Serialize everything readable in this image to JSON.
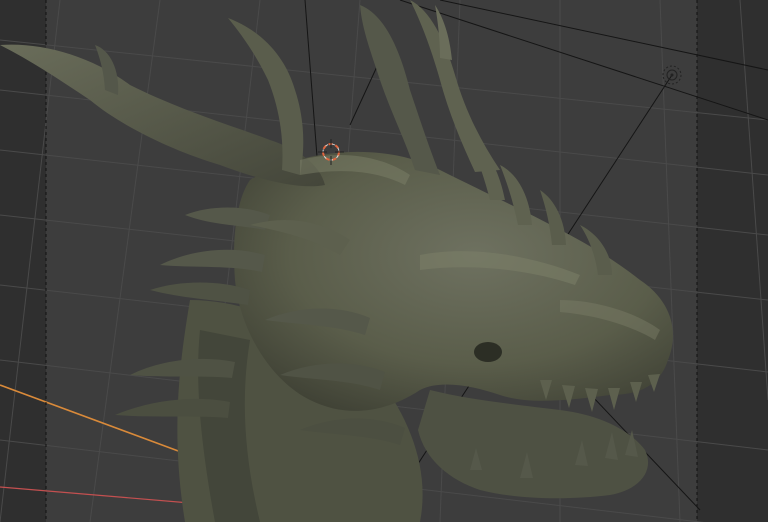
{
  "scene": {
    "object": "dragon-head-sculpt",
    "colors": {
      "viewport_background": "#3d3d3d",
      "passepartout": "#2f2f2f",
      "camera_frame_dashed": "#111111",
      "grid_line": "#4a4a4a",
      "x_axis": "#d98a3a",
      "y_axis": "#c45050",
      "sculpt_base": "#5b5e4b",
      "sculpt_shadow": "#3b3d30",
      "sculpt_highlight": "#7c7f68",
      "origin_ring": "#e0663f",
      "light_gizmo": "#222222"
    },
    "icons": {
      "scene_origin": "crosshair-origin-icon",
      "light_object": "light-gizmo-icon"
    }
  }
}
